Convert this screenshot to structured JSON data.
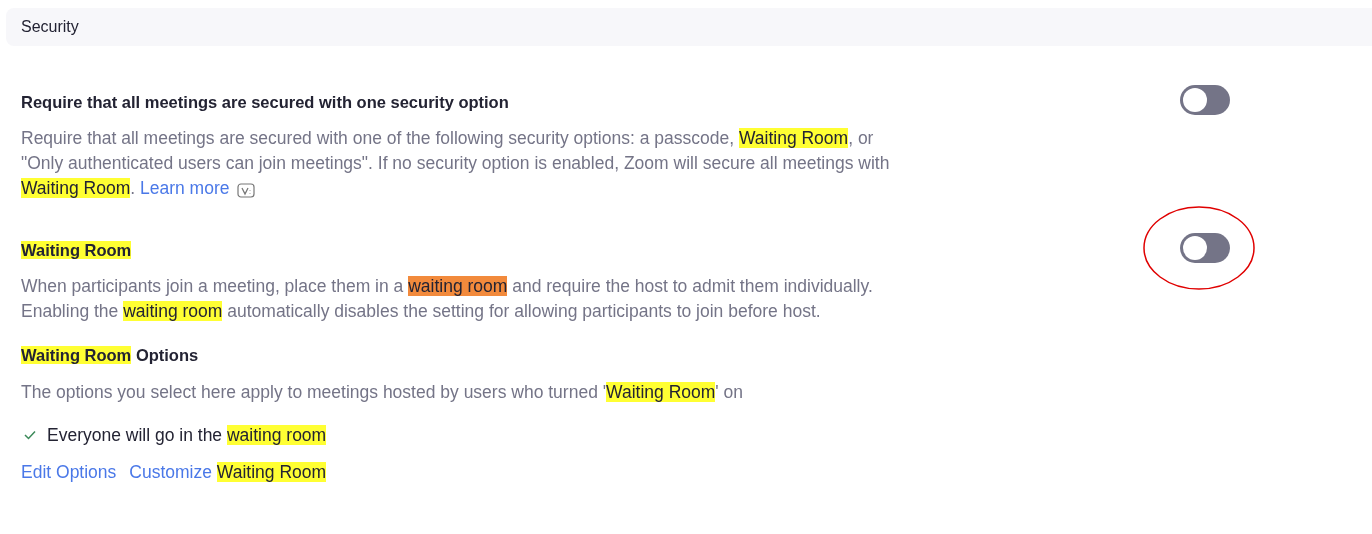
{
  "section": {
    "title": "Security"
  },
  "settings": [
    {
      "title": [
        {
          "text": "Require that all meetings are secured with one security option"
        }
      ],
      "on": false,
      "circled": false,
      "description": [
        {
          "text": "Require that all meetings are secured with one of the following security options: a passcode, "
        },
        {
          "text": "Waiting Room",
          "color": "#ffff33"
        },
        {
          "text": ", or \"Only authenticated users can join meetings\". If no security option is enabled, Zoom will secure all meetings with "
        },
        {
          "text": "Waiting Room",
          "color": "#ffff33"
        },
        {
          "text": ". "
        },
        {
          "text": "Learn more",
          "kind": "link"
        },
        {
          "kind": "icon"
        }
      ]
    },
    {
      "title": [
        {
          "text": "Waiting Room",
          "color": "#ffff33"
        }
      ],
      "on": false,
      "circled": true,
      "description": [
        {
          "text": "When participants join a meeting, place them in a "
        },
        {
          "text": "waiting room",
          "color": "#f28a3c"
        },
        {
          "text": " and require the host to admit them individually. Enabling the "
        },
        {
          "text": "waiting room",
          "color": "#ffff33"
        },
        {
          "text": " automatically disables the setting for allowing participants to join before host."
        }
      ]
    }
  ],
  "options": {
    "title": [
      {
        "text": "Waiting Room",
        "color": "#ffff33"
      },
      {
        "text": " Options"
      }
    ],
    "description": [
      {
        "text": "The options you select here apply to meetings hosted by users who turned '"
      },
      {
        "text": "Waiting Room",
        "color": "#ffff33"
      },
      {
        "text": "' on"
      }
    ],
    "items": [
      {
        "checked": true,
        "label": [
          {
            "text": "Everyone will go in the "
          },
          {
            "text": "waiting room",
            "color": "#ffff33"
          }
        ]
      }
    ],
    "links": [
      [
        {
          "text": "Edit Options"
        }
      ],
      [
        {
          "text": "Customize "
        },
        {
          "text": "Waiting Room",
          "color": "#ffff33"
        }
      ]
    ]
  }
}
